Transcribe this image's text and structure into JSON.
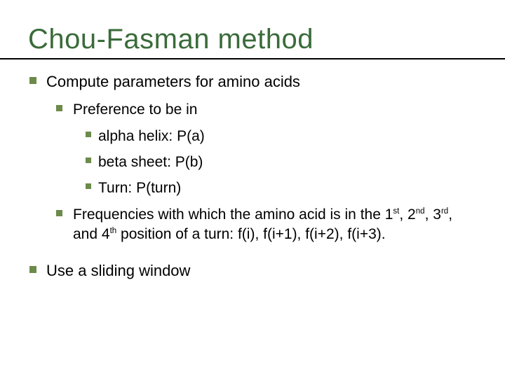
{
  "title": "Chou-Fasman method",
  "bullets": {
    "compute": "Compute parameters for amino acids",
    "preference": "Preference to be in",
    "alpha": "alpha helix: P(a)",
    "beta": "beta sheet: P(b)",
    "turn": "Turn: P(turn)",
    "freq_pre": "Frequencies with which the amino acid is in the 1",
    "freq_sup1": "st",
    "freq_mid1": ", 2",
    "freq_sup2": "nd",
    "freq_mid2": ", 3",
    "freq_sup3": "rd",
    "freq_mid3": ", and 4",
    "freq_sup4": "th",
    "freq_post": " position of a turn: f(i), f(i+1), f(i+2), f(i+3).",
    "sliding": "Use a sliding window"
  }
}
